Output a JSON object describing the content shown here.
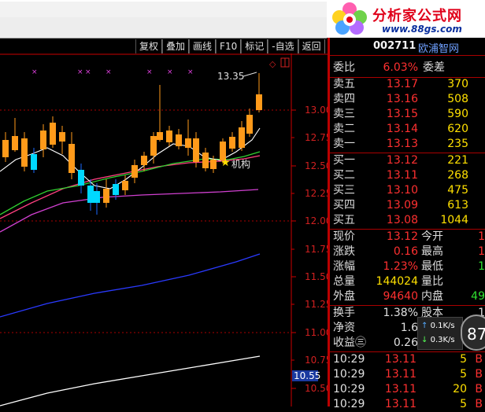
{
  "toolbar": [
    "复权",
    "叠加",
    "画线",
    "F10",
    "标记",
    "自选",
    "返回"
  ],
  "logo": {
    "title": "分析家公式网",
    "url": "www.88gs.com"
  },
  "chart_data": {
    "type": "candlestick",
    "y_labels": [
      "13.00",
      "12.75",
      "12.50",
      "12.25",
      "12.00",
      "11.75",
      "11.50",
      "11.25",
      "11.00",
      "10.75",
      "10.50"
    ],
    "price_marker": "10.55",
    "high_label": "13.35",
    "annotation": "机构"
  },
  "stock": {
    "code": "002711",
    "name": "欧浦智网"
  },
  "order_book": {
    "weibi_label": "委比",
    "weibi_value": "6.03%",
    "weicha_label": "委差",
    "sells": [
      {
        "label": "卖五",
        "price": "13.17",
        "vol": "370"
      },
      {
        "label": "卖四",
        "price": "13.16",
        "vol": "508"
      },
      {
        "label": "卖三",
        "price": "13.15",
        "vol": "590"
      },
      {
        "label": "卖二",
        "price": "13.14",
        "vol": "620"
      },
      {
        "label": "卖一",
        "price": "13.13",
        "vol": "235"
      }
    ],
    "buys": [
      {
        "label": "买一",
        "price": "13.12",
        "vol": "221"
      },
      {
        "label": "买二",
        "price": "13.11",
        "vol": "268"
      },
      {
        "label": "买三",
        "price": "13.10",
        "vol": "475"
      },
      {
        "label": "买四",
        "price": "13.09",
        "vol": "613"
      },
      {
        "label": "买五",
        "price": "13.08",
        "vol": "1044"
      }
    ]
  },
  "quote": [
    {
      "label": "现价",
      "value": "13.12",
      "label2": "今开",
      "value2": "1"
    },
    {
      "label": "涨跌",
      "value": "0.16",
      "label2": "最高",
      "value2": "1"
    },
    {
      "label": "涨幅",
      "value": "1.23%",
      "label2": "最低",
      "value2": "1"
    },
    {
      "label": "总量",
      "value": "144024",
      "label2": "量比",
      "value2": ""
    },
    {
      "label": "外盘",
      "value": "94640",
      "label2": "内盘",
      "value2": "49"
    },
    {
      "label": "换手",
      "value": "1.38%",
      "label2": "股本",
      "value2": "1"
    },
    {
      "label": "净资",
      "value": "1.6",
      "label2": "",
      "value2": ""
    },
    {
      "label": "收益㊂",
      "value": "0.26",
      "label2": "",
      "value2": ""
    }
  ],
  "speed": {
    "up": "0.1K/s",
    "down": "0.3K/s",
    "gauge": "87"
  },
  "ticks": [
    {
      "time": "10:29",
      "price": "13.11",
      "vol": "5",
      "side": "B"
    },
    {
      "time": "10:29",
      "price": "13.11",
      "vol": "5",
      "side": "B"
    },
    {
      "time": "10:29",
      "price": "13.11",
      "vol": "20",
      "side": "B"
    },
    {
      "time": "10:29",
      "price": "13.11",
      "vol": "5",
      "side": "B"
    }
  ]
}
